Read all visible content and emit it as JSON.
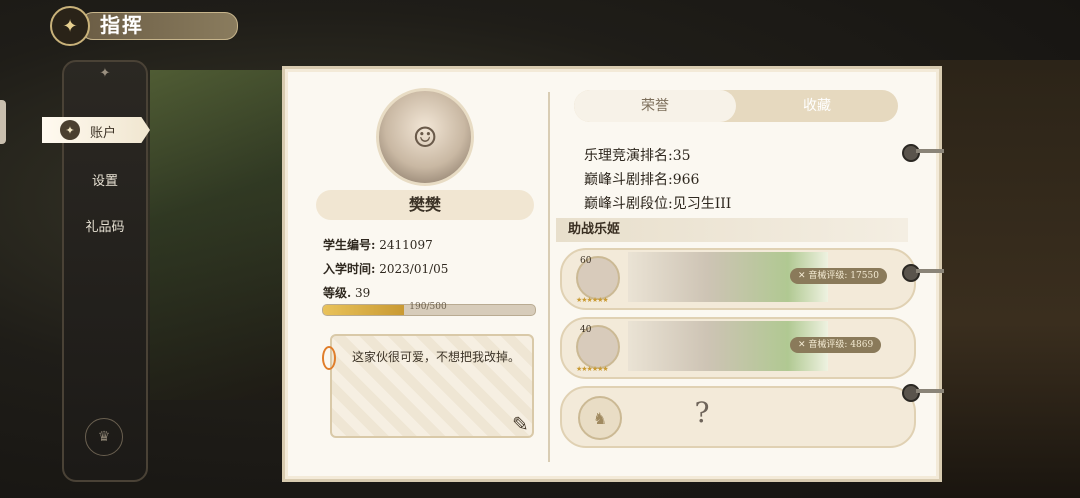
{
  "title": {
    "text": "指挥"
  },
  "side_menu": {
    "items": [
      "账户",
      "设置",
      "礼品码"
    ],
    "active_index": 0
  },
  "profile": {
    "name": "樊樊",
    "student_id_label": "学生编号:",
    "student_id": "2411097",
    "enroll_label": "入学时间:",
    "enroll_date": "2023/01/05",
    "level_label": "等级.",
    "level": "39",
    "exp_text": "190/500",
    "exp_fraction": 0.38,
    "signature": "这家伙很可爱，不想把我改掉。"
  },
  "tabs": {
    "honor": "荣誉",
    "collection": "收藏",
    "active": "honor"
  },
  "stats": [
    {
      "label": "乐理竞演排名:",
      "value": "35"
    },
    {
      "label": "巅峰斗剧排名:",
      "value": "966"
    },
    {
      "label": "巅峰斗剧段位:",
      "value": "见习生III"
    }
  ],
  "support": {
    "title": "助战乐姬",
    "cards": [
      {
        "level": "60",
        "stars": "★★★★★★",
        "power": "✕ 音械评级: 17550"
      },
      {
        "level": "40",
        "stars": "★★★★★★",
        "power": "✕ 音械评级: 4869"
      }
    ],
    "empty_question": "?"
  },
  "colors": {
    "accent": "#c99a33",
    "panel": "#fbf8f1",
    "tab_active": "#f7f2e8"
  }
}
